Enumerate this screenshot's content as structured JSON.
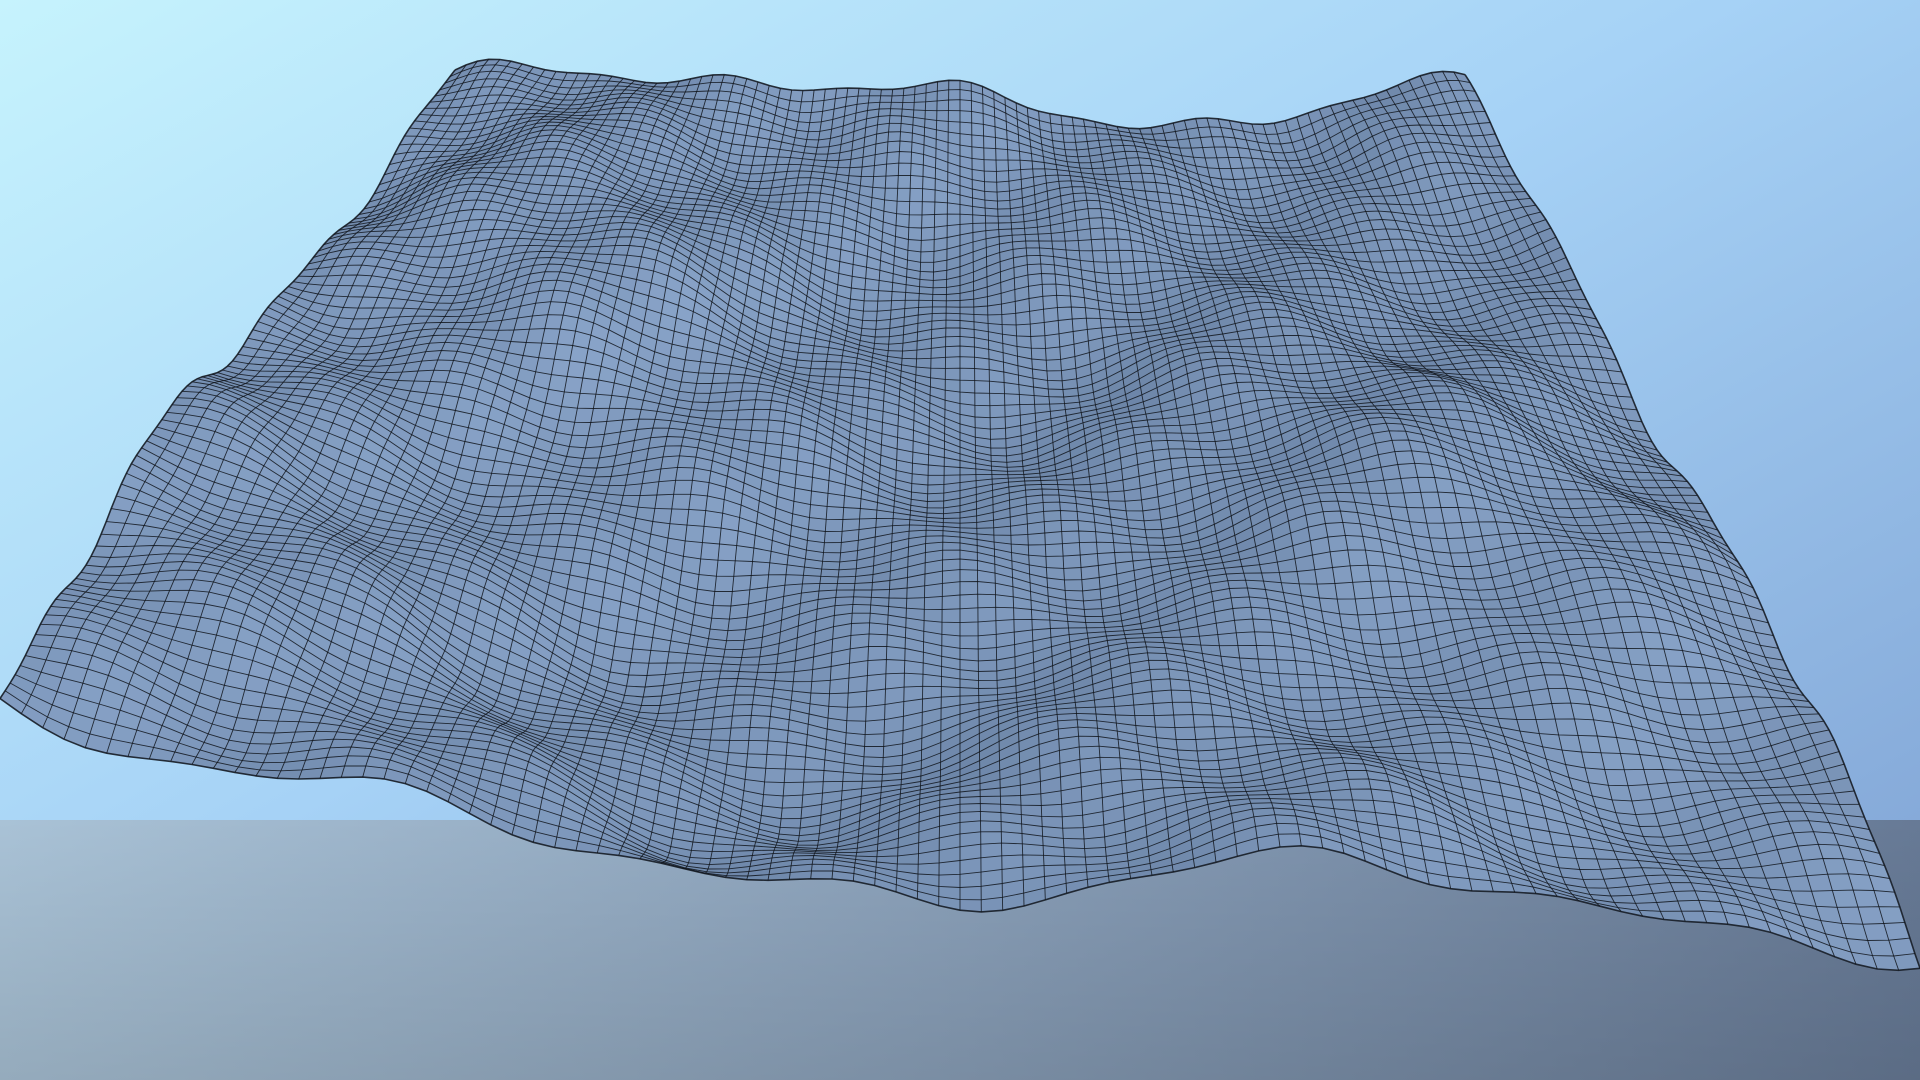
{
  "scene": {
    "subject": "terrain-wireframe-mesh",
    "colors": {
      "sky_top": "#c6f3fd",
      "sky_mid": "#9ec6ef",
      "sky_right": "#7ea4d6",
      "ground_left": "#a7bfd3",
      "ground_right": "#6a7d99",
      "mesh_fill_light": "#9cbbe2",
      "mesh_fill_dark": "#4e6686",
      "grid_line": "#10151c"
    }
  }
}
